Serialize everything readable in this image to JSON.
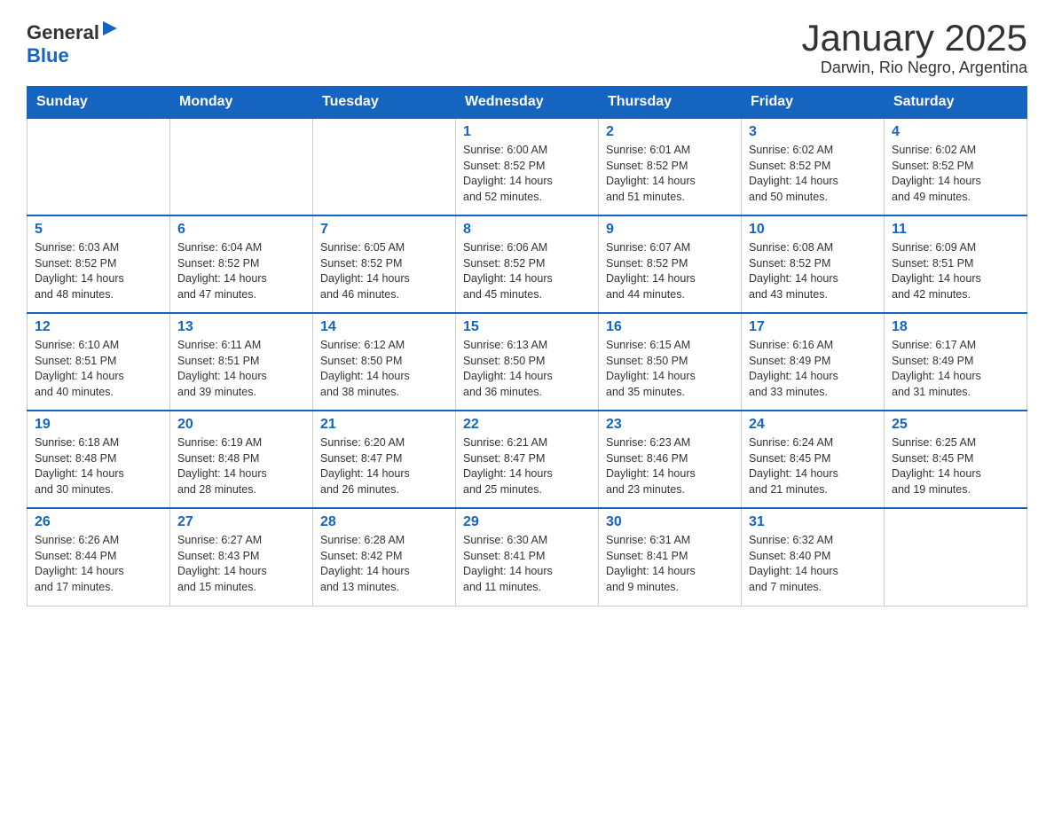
{
  "header": {
    "logo_general": "General",
    "logo_blue": "Blue",
    "title": "January 2025",
    "subtitle": "Darwin, Rio Negro, Argentina"
  },
  "days_of_week": [
    "Sunday",
    "Monday",
    "Tuesday",
    "Wednesday",
    "Thursday",
    "Friday",
    "Saturday"
  ],
  "weeks": [
    [
      {
        "day": "",
        "info": ""
      },
      {
        "day": "",
        "info": ""
      },
      {
        "day": "",
        "info": ""
      },
      {
        "day": "1",
        "info": "Sunrise: 6:00 AM\nSunset: 8:52 PM\nDaylight: 14 hours\nand 52 minutes."
      },
      {
        "day": "2",
        "info": "Sunrise: 6:01 AM\nSunset: 8:52 PM\nDaylight: 14 hours\nand 51 minutes."
      },
      {
        "day": "3",
        "info": "Sunrise: 6:02 AM\nSunset: 8:52 PM\nDaylight: 14 hours\nand 50 minutes."
      },
      {
        "day": "4",
        "info": "Sunrise: 6:02 AM\nSunset: 8:52 PM\nDaylight: 14 hours\nand 49 minutes."
      }
    ],
    [
      {
        "day": "5",
        "info": "Sunrise: 6:03 AM\nSunset: 8:52 PM\nDaylight: 14 hours\nand 48 minutes."
      },
      {
        "day": "6",
        "info": "Sunrise: 6:04 AM\nSunset: 8:52 PM\nDaylight: 14 hours\nand 47 minutes."
      },
      {
        "day": "7",
        "info": "Sunrise: 6:05 AM\nSunset: 8:52 PM\nDaylight: 14 hours\nand 46 minutes."
      },
      {
        "day": "8",
        "info": "Sunrise: 6:06 AM\nSunset: 8:52 PM\nDaylight: 14 hours\nand 45 minutes."
      },
      {
        "day": "9",
        "info": "Sunrise: 6:07 AM\nSunset: 8:52 PM\nDaylight: 14 hours\nand 44 minutes."
      },
      {
        "day": "10",
        "info": "Sunrise: 6:08 AM\nSunset: 8:52 PM\nDaylight: 14 hours\nand 43 minutes."
      },
      {
        "day": "11",
        "info": "Sunrise: 6:09 AM\nSunset: 8:51 PM\nDaylight: 14 hours\nand 42 minutes."
      }
    ],
    [
      {
        "day": "12",
        "info": "Sunrise: 6:10 AM\nSunset: 8:51 PM\nDaylight: 14 hours\nand 40 minutes."
      },
      {
        "day": "13",
        "info": "Sunrise: 6:11 AM\nSunset: 8:51 PM\nDaylight: 14 hours\nand 39 minutes."
      },
      {
        "day": "14",
        "info": "Sunrise: 6:12 AM\nSunset: 8:50 PM\nDaylight: 14 hours\nand 38 minutes."
      },
      {
        "day": "15",
        "info": "Sunrise: 6:13 AM\nSunset: 8:50 PM\nDaylight: 14 hours\nand 36 minutes."
      },
      {
        "day": "16",
        "info": "Sunrise: 6:15 AM\nSunset: 8:50 PM\nDaylight: 14 hours\nand 35 minutes."
      },
      {
        "day": "17",
        "info": "Sunrise: 6:16 AM\nSunset: 8:49 PM\nDaylight: 14 hours\nand 33 minutes."
      },
      {
        "day": "18",
        "info": "Sunrise: 6:17 AM\nSunset: 8:49 PM\nDaylight: 14 hours\nand 31 minutes."
      }
    ],
    [
      {
        "day": "19",
        "info": "Sunrise: 6:18 AM\nSunset: 8:48 PM\nDaylight: 14 hours\nand 30 minutes."
      },
      {
        "day": "20",
        "info": "Sunrise: 6:19 AM\nSunset: 8:48 PM\nDaylight: 14 hours\nand 28 minutes."
      },
      {
        "day": "21",
        "info": "Sunrise: 6:20 AM\nSunset: 8:47 PM\nDaylight: 14 hours\nand 26 minutes."
      },
      {
        "day": "22",
        "info": "Sunrise: 6:21 AM\nSunset: 8:47 PM\nDaylight: 14 hours\nand 25 minutes."
      },
      {
        "day": "23",
        "info": "Sunrise: 6:23 AM\nSunset: 8:46 PM\nDaylight: 14 hours\nand 23 minutes."
      },
      {
        "day": "24",
        "info": "Sunrise: 6:24 AM\nSunset: 8:45 PM\nDaylight: 14 hours\nand 21 minutes."
      },
      {
        "day": "25",
        "info": "Sunrise: 6:25 AM\nSunset: 8:45 PM\nDaylight: 14 hours\nand 19 minutes."
      }
    ],
    [
      {
        "day": "26",
        "info": "Sunrise: 6:26 AM\nSunset: 8:44 PM\nDaylight: 14 hours\nand 17 minutes."
      },
      {
        "day": "27",
        "info": "Sunrise: 6:27 AM\nSunset: 8:43 PM\nDaylight: 14 hours\nand 15 minutes."
      },
      {
        "day": "28",
        "info": "Sunrise: 6:28 AM\nSunset: 8:42 PM\nDaylight: 14 hours\nand 13 minutes."
      },
      {
        "day": "29",
        "info": "Sunrise: 6:30 AM\nSunset: 8:41 PM\nDaylight: 14 hours\nand 11 minutes."
      },
      {
        "day": "30",
        "info": "Sunrise: 6:31 AM\nSunset: 8:41 PM\nDaylight: 14 hours\nand 9 minutes."
      },
      {
        "day": "31",
        "info": "Sunrise: 6:32 AM\nSunset: 8:40 PM\nDaylight: 14 hours\nand 7 minutes."
      },
      {
        "day": "",
        "info": ""
      }
    ]
  ]
}
